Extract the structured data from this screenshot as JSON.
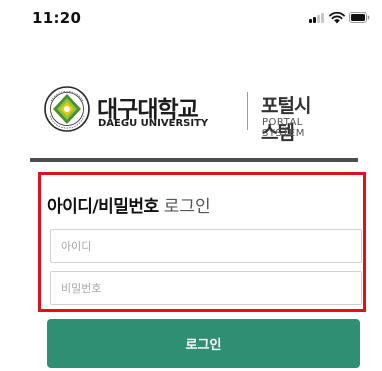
{
  "status_bar": {
    "time": "11:20",
    "icons": [
      "signal-icon",
      "wifi-icon",
      "battery-icon"
    ]
  },
  "logo": {
    "university_name_kr": "대구대학교",
    "university_name_en": "DAEGU UNIVERSITY",
    "portal_name_kr": "포털시스템",
    "portal_name_en": "PORTAL SYSTEM",
    "emblem_icon": "university-emblem-icon"
  },
  "login_form": {
    "heading_bold": "아이디/비밀번호",
    "heading_light": "로그인",
    "id_placeholder": "아이디",
    "id_value": "",
    "password_placeholder": "비밀번호",
    "password_value": "",
    "submit_label": "로그인"
  },
  "colors": {
    "primary_button": "#2e8f73",
    "highlight_border": "#e0101d",
    "divider": "#4d4d4d",
    "emblem_green": "#4e8f2a"
  }
}
